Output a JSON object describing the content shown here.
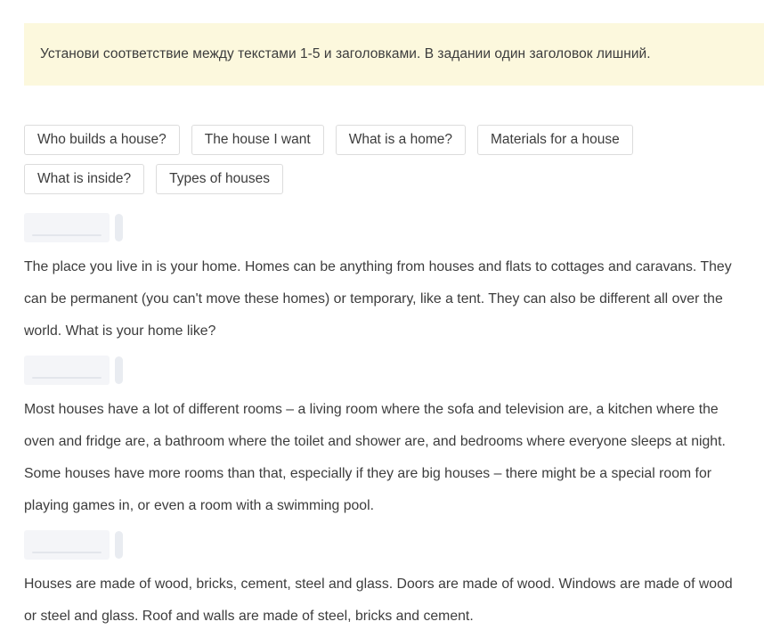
{
  "instruction": {
    "text": "Установи соответствие между текстами 1-5 и заголовками. В задании один заголовок лишний.",
    "background_color": "#fcf8dd"
  },
  "heading_options": [
    {
      "label": "Who builds a house?"
    },
    {
      "label": "The house I want"
    },
    {
      "label": "What is a home?"
    },
    {
      "label": "Materials for a house"
    },
    {
      "label": "What is inside?"
    },
    {
      "label": "Types of houses"
    }
  ],
  "tasks": [
    {
      "answer_value": "",
      "text": "The place you live in is your home. Homes can be anything from houses and flats to cottages and caravans. They can be permanent (you can't move these homes) or temporary, like a tent. They can also be different all over the world. What is your home like?"
    },
    {
      "answer_value": "",
      "text": "Most houses have a lot of different rooms – a living room where the sofa and television are, a kitchen where the oven and fridge are, a bathroom where the toilet and shower are, and bedrooms where everyone sleeps at night. Some houses have more rooms than that, especially if they are big houses – there might be a special room for playing games in, or even a room with a swimming pool."
    },
    {
      "answer_value": "",
      "text": "Houses are made of wood, bricks, cement, steel and glass. Doors are made of wood. Windows are made of wood or steel and glass. Roof and walls are made of steel, bricks and cement."
    }
  ],
  "colors": {
    "text": "#3c3c3c",
    "chip_border": "#dcdcdc",
    "dropzone_background": "#f4f5f8",
    "banner_background": "#fcf8dd"
  }
}
